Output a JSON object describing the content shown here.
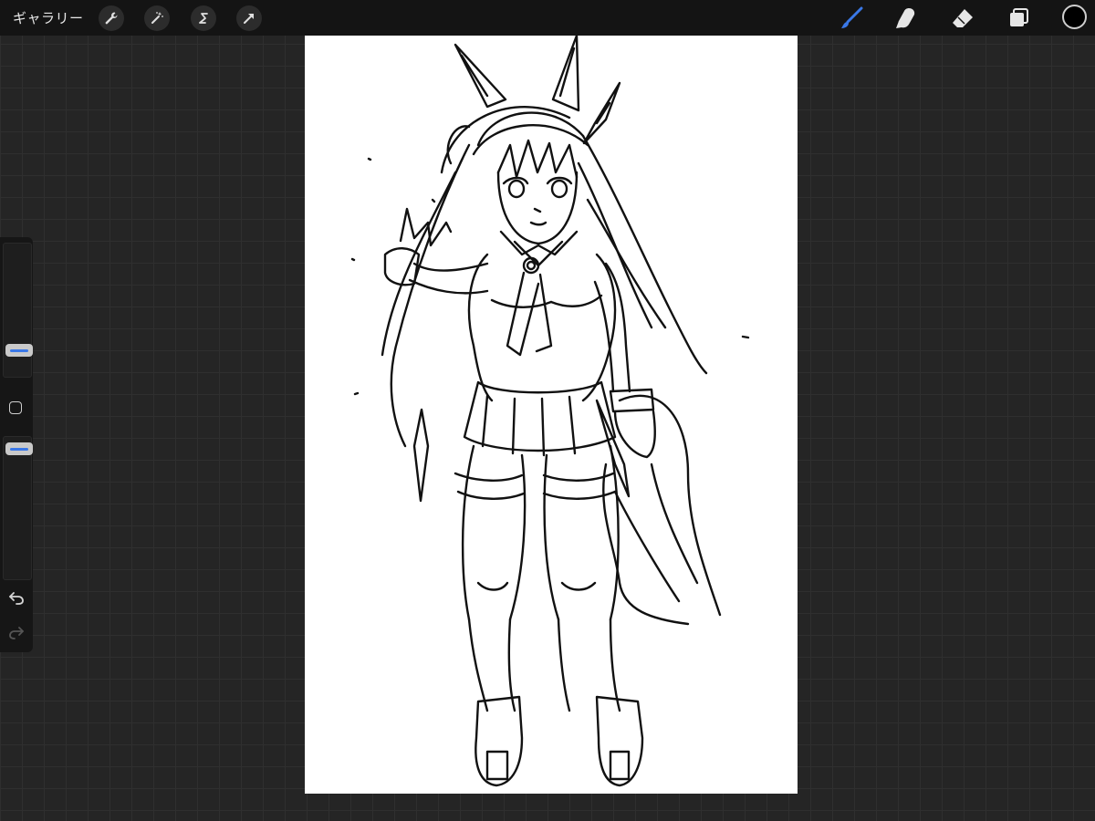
{
  "topbar": {
    "gallery_label": "ギャラリー",
    "left_tools": [
      {
        "icon": "wrench-icon",
        "name": "actions"
      },
      {
        "icon": "magic-wand-icon",
        "name": "adjustments"
      },
      {
        "icon": "selection-s-icon",
        "name": "selection"
      },
      {
        "icon": "arrow-cursor-icon",
        "name": "transform"
      }
    ],
    "right_tools": [
      {
        "icon": "brush-icon",
        "name": "paint",
        "active": true,
        "color": "#3a78e8"
      },
      {
        "icon": "smudge-finger-icon",
        "name": "smudge",
        "active": false
      },
      {
        "icon": "eraser-icon",
        "name": "eraser",
        "active": false
      },
      {
        "icon": "layers-icon",
        "name": "layers",
        "active": false
      }
    ],
    "current_color": "#000000"
  },
  "sidebar": {
    "brush_size_level": 0.72,
    "opacity_level": 0.68,
    "accent_color": "#3a78e8",
    "modify_icon": "square-modify-icon",
    "undo_icon": "undo-icon",
    "redo_icon": "redo-icon"
  },
  "canvas": {
    "content": "line-art-sketch-character",
    "background": "#ffffff"
  }
}
